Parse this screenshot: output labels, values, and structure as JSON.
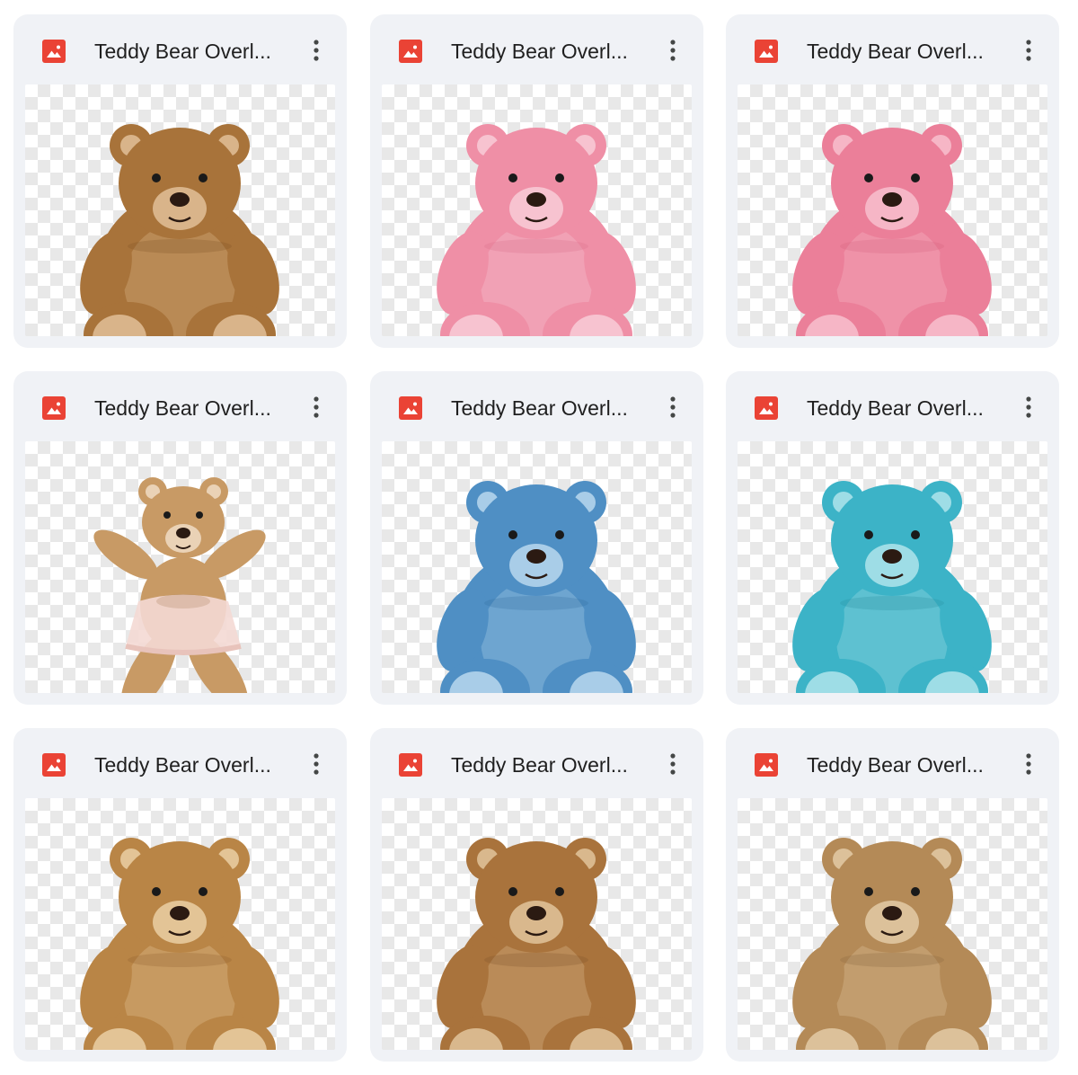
{
  "files": [
    {
      "title": "Teddy Bear Overl...",
      "color": "#a8733a",
      "light": "#d9b48a",
      "dark": "#7a4f22",
      "pose": "sit",
      "icon": "image-file-icon"
    },
    {
      "title": "Teddy Bear Overl...",
      "color": "#ef8fa6",
      "light": "#f7c3d0",
      "dark": "#d86a86",
      "pose": "sit",
      "icon": "image-file-icon"
    },
    {
      "title": "Teddy Bear Overl...",
      "color": "#eb7f99",
      "light": "#f6b6c6",
      "dark": "#d25f7d",
      "pose": "sit",
      "icon": "image-file-icon"
    },
    {
      "title": "Teddy Bear Overl...",
      "color": "#c89a65",
      "light": "#ead2b6",
      "dark": "#8f6538",
      "pose": "dance",
      "icon": "image-file-icon"
    },
    {
      "title": "Teddy Bear Overl...",
      "color": "#4f8fc4",
      "light": "#a9cde8",
      "dark": "#2f6a9c",
      "pose": "sit",
      "icon": "image-file-icon"
    },
    {
      "title": "Teddy Bear Overl...",
      "color": "#3cb3c7",
      "light": "#9edde6",
      "dark": "#238a9c",
      "pose": "sit",
      "icon": "image-file-icon"
    },
    {
      "title": "Teddy Bear Overl...",
      "color": "#b98546",
      "light": "#e3c496",
      "dark": "#8a5d2b",
      "pose": "sit",
      "icon": "image-file-icon"
    },
    {
      "title": "Teddy Bear Overl...",
      "color": "#a9733c",
      "light": "#d9b88d",
      "dark": "#7c5026",
      "pose": "sit",
      "icon": "image-file-icon"
    },
    {
      "title": "Teddy Bear Overl...",
      "color": "#b48a57",
      "light": "#dcc19a",
      "dark": "#85623a",
      "pose": "sit",
      "icon": "image-file-icon"
    }
  ],
  "colors": {
    "icon_red": "#ea4335",
    "card_bg": "#f0f2f6",
    "menu_icon": "#444746"
  }
}
